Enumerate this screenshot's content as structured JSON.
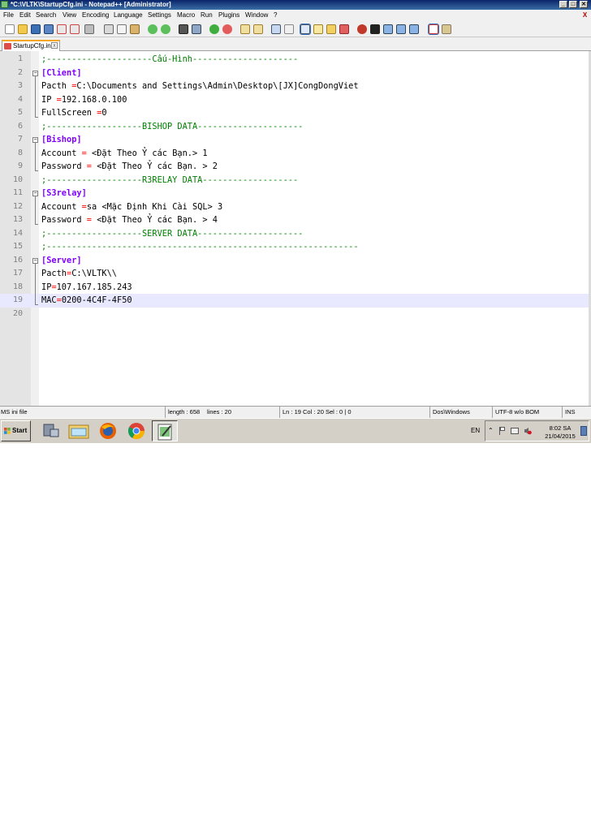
{
  "window": {
    "title": "*C:\\VLTK\\StartupCfg.ini - Notepad++ [Administrator]",
    "buttons": {
      "minimize": "_",
      "maximize": "□",
      "close": "✕"
    }
  },
  "menu": [
    "File",
    "Edit",
    "Search",
    "View",
    "Encoding",
    "Language",
    "Settings",
    "Macro",
    "Run",
    "Plugins",
    "Window",
    "?"
  ],
  "menu_close": "X",
  "toolbar_icons": [
    "new-file-icon",
    "open-file-icon",
    "save-icon",
    "save-all-icon",
    "close-icon",
    "close-all-icon",
    "print-icon",
    "cut-icon",
    "copy-icon",
    "paste-icon",
    "undo-icon",
    "redo-icon",
    "find-icon",
    "replace-icon",
    "zoom-in-icon",
    "zoom-out-icon",
    "sync-v-icon",
    "sync-h-icon",
    "wrap-icon",
    "all-chars-icon",
    "indent-guide-icon",
    "user-lang-icon",
    "doc-map-icon",
    "function-list-icon",
    "folder-workspace-icon",
    "record-macro-icon",
    "stop-macro-icon",
    "play-macro-icon",
    "run-macro-multi-icon",
    "save-macro-icon",
    "spell-check-icon",
    "spell-hl-icon"
  ],
  "tab": {
    "label": "StartupCfg.ini",
    "close": "x"
  },
  "editor": {
    "current_line": 19,
    "lines": [
      {
        "n": "1",
        "tokens": [
          {
            "t": "comment",
            "v": ";---------------------Cấu-Hình---------------------"
          }
        ]
      },
      {
        "n": "2",
        "tokens": [
          {
            "t": "section",
            "v": "[Client]"
          }
        ]
      },
      {
        "n": "3",
        "tokens": [
          {
            "t": "key",
            "v": "Pacth "
          },
          {
            "t": "eq",
            "v": "="
          },
          {
            "t": "val",
            "v": "C:\\Documents and Settings\\Admin\\Desktop\\[JX]CongDongViet"
          }
        ]
      },
      {
        "n": "4",
        "tokens": [
          {
            "t": "key",
            "v": "IP "
          },
          {
            "t": "eq",
            "v": "="
          },
          {
            "t": "val",
            "v": "192.168.0.100"
          }
        ]
      },
      {
        "n": "5",
        "tokens": [
          {
            "t": "key",
            "v": "FullScreen "
          },
          {
            "t": "eq",
            "v": "="
          },
          {
            "t": "val",
            "v": "0"
          }
        ]
      },
      {
        "n": "6",
        "tokens": [
          {
            "t": "comment",
            "v": ";-------------------BISHOP DATA---------------------"
          }
        ]
      },
      {
        "n": "7",
        "tokens": [
          {
            "t": "section",
            "v": "[Bishop]"
          }
        ]
      },
      {
        "n": "8",
        "tokens": [
          {
            "t": "key",
            "v": "Account "
          },
          {
            "t": "eq",
            "v": "="
          },
          {
            "t": "val",
            "v": " <Đặt Theo Ỷ các Bạn.> 1"
          }
        ]
      },
      {
        "n": "9",
        "tokens": [
          {
            "t": "key",
            "v": "Password "
          },
          {
            "t": "eq",
            "v": "="
          },
          {
            "t": "val",
            "v": " <Đặt Theo Ỷ các Bạn. > 2"
          }
        ]
      },
      {
        "n": "10",
        "tokens": [
          {
            "t": "comment",
            "v": ";-------------------R3RELAY DATA-------------------"
          }
        ]
      },
      {
        "n": "11",
        "tokens": [
          {
            "t": "section",
            "v": "[S3relay]"
          }
        ]
      },
      {
        "n": "12",
        "tokens": [
          {
            "t": "key",
            "v": "Account "
          },
          {
            "t": "eq",
            "v": "="
          },
          {
            "t": "val",
            "v": "sa <Mặc Định Khi Cài SQL> 3"
          }
        ]
      },
      {
        "n": "13",
        "tokens": [
          {
            "t": "key",
            "v": "Password "
          },
          {
            "t": "eq",
            "v": "="
          },
          {
            "t": "val",
            "v": " <Đặt Theo Ỷ các Bạn. > 4"
          }
        ]
      },
      {
        "n": "14",
        "tokens": [
          {
            "t": "comment",
            "v": ";-------------------SERVER DATA---------------------"
          }
        ]
      },
      {
        "n": "15",
        "tokens": [
          {
            "t": "comment",
            "v": ";--------------------------------------------------------------"
          }
        ]
      },
      {
        "n": "16",
        "tokens": [
          {
            "t": "section",
            "v": "[Server]"
          }
        ]
      },
      {
        "n": "17",
        "tokens": [
          {
            "t": "key",
            "v": "Pacth"
          },
          {
            "t": "eq",
            "v": "="
          },
          {
            "t": "val",
            "v": "C:\\VLTK\\\\"
          }
        ]
      },
      {
        "n": "18",
        "tokens": [
          {
            "t": "key",
            "v": "IP"
          },
          {
            "t": "eq",
            "v": "="
          },
          {
            "t": "val",
            "v": "107.167.185.243"
          }
        ]
      },
      {
        "n": "19",
        "tokens": [
          {
            "t": "key",
            "v": "MAC"
          },
          {
            "t": "eq",
            "v": "="
          },
          {
            "t": "val",
            "v": "0200-4C4F-4F50"
          }
        ]
      },
      {
        "n": "20",
        "tokens": []
      }
    ]
  },
  "status": {
    "file_type": "MS ini file",
    "length": "length : 658",
    "lines": "lines : 20",
    "position": "Ln : 19    Col : 20    Sel : 0 | 0",
    "eol": "Dos\\Windows",
    "encoding": "UTF-8 w/o BOM",
    "mode": "INS"
  },
  "taskbar": {
    "start_label": "Start",
    "apps": [
      "server-manager-icon",
      "file-explorer-icon",
      "firefox-icon",
      "chrome-icon",
      "notepad-plus-plus-icon"
    ],
    "language": "EN",
    "time": "8:02 SA",
    "date": "21/04/2015"
  }
}
